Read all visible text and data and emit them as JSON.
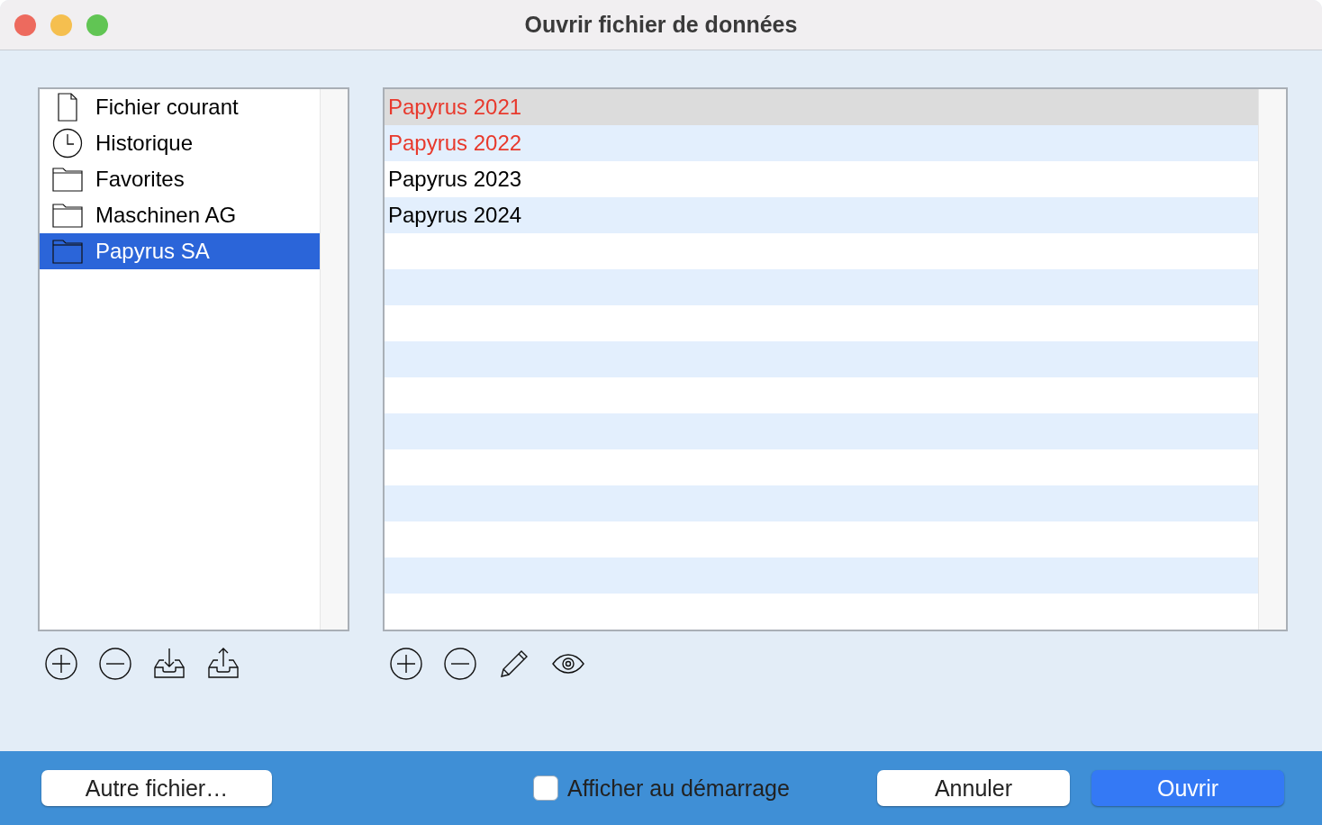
{
  "window": {
    "title": "Ouvrir fichier de données"
  },
  "sidebar": {
    "items": [
      {
        "label": "Fichier courant",
        "kind": "document",
        "selected": false
      },
      {
        "label": "Historique",
        "kind": "clock",
        "selected": false
      },
      {
        "label": "Favorites",
        "kind": "folder",
        "selected": false
      },
      {
        "label": "Maschinen AG",
        "kind": "folder",
        "selected": false
      },
      {
        "label": "Papyrus SA",
        "kind": "folder",
        "selected": true
      }
    ],
    "toolbar": [
      {
        "kind": "add"
      },
      {
        "kind": "remove"
      },
      {
        "kind": "import"
      },
      {
        "kind": "export"
      }
    ]
  },
  "files": {
    "items": [
      {
        "label": "Papyrus 2021",
        "color": "#e8392c",
        "selected": true
      },
      {
        "label": "Papyrus 2022",
        "color": "#e8392c",
        "selected": false
      },
      {
        "label": "Papyrus 2023",
        "color": "#000000",
        "selected": false
      },
      {
        "label": "Papyrus 2024",
        "color": "#000000",
        "selected": false
      }
    ],
    "toolbar": [
      {
        "kind": "add"
      },
      {
        "kind": "remove"
      },
      {
        "kind": "edit"
      },
      {
        "kind": "view"
      }
    ]
  },
  "footer": {
    "other_button": "Autre fichier…",
    "show_at_startup": {
      "label": "Afficher au démarrage",
      "checked": false
    },
    "cancel_button": "Annuler",
    "open_button": "Ouvrir"
  }
}
